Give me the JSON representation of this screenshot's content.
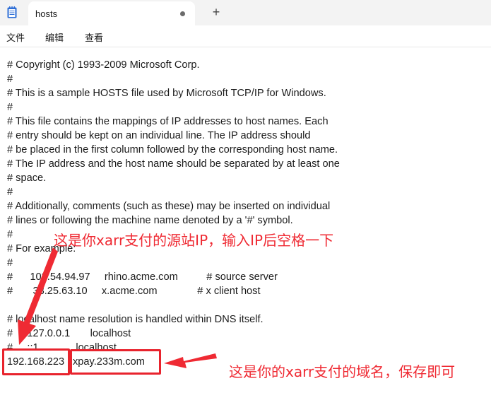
{
  "tab": {
    "title": "hosts"
  },
  "new_tab_glyph": "+",
  "menu": [
    "文件",
    "编辑",
    "查看"
  ],
  "lines": [
    "# Copyright (c) 1993-2009 Microsoft Corp.",
    "#",
    "# This is a sample HOSTS file used by Microsoft TCP/IP for Windows.",
    "#",
    "# This file contains the mappings of IP addresses to host names. Each",
    "# entry should be kept on an individual line. The IP address should",
    "# be placed in the first column followed by the corresponding host name.",
    "# The IP address and the host name should be separated by at least one",
    "# space.",
    "#",
    "# Additionally, comments (such as these) may be inserted on individual",
    "# lines or following the machine name denoted by a '#' symbol.",
    "#",
    "# For example:",
    "#",
    "#      102.54.94.97     rhino.acme.com          # source server",
    "#       38.25.63.10     x.acme.com              # x client host",
    "",
    "# localhost name resolution is handled within DNS itself.",
    "#     127.0.0.1       localhost",
    "#     ::1             localhost"
  ],
  "entry": {
    "ip": "192.168.223",
    "domain": "xpay.233m.com"
  },
  "annotations": {
    "ip_note": "这是你xarr支付的源站IP，输入IP后空格一下",
    "domain_note": "这是你的xarr支付的域名，保存即可"
  },
  "colors": {
    "annotation": "#e8232d",
    "titlebar": "#f3f3f3"
  },
  "icons": {
    "app": "notepad-icon",
    "close_dot": "unsaved-dot-icon",
    "new_tab": "plus-icon"
  }
}
